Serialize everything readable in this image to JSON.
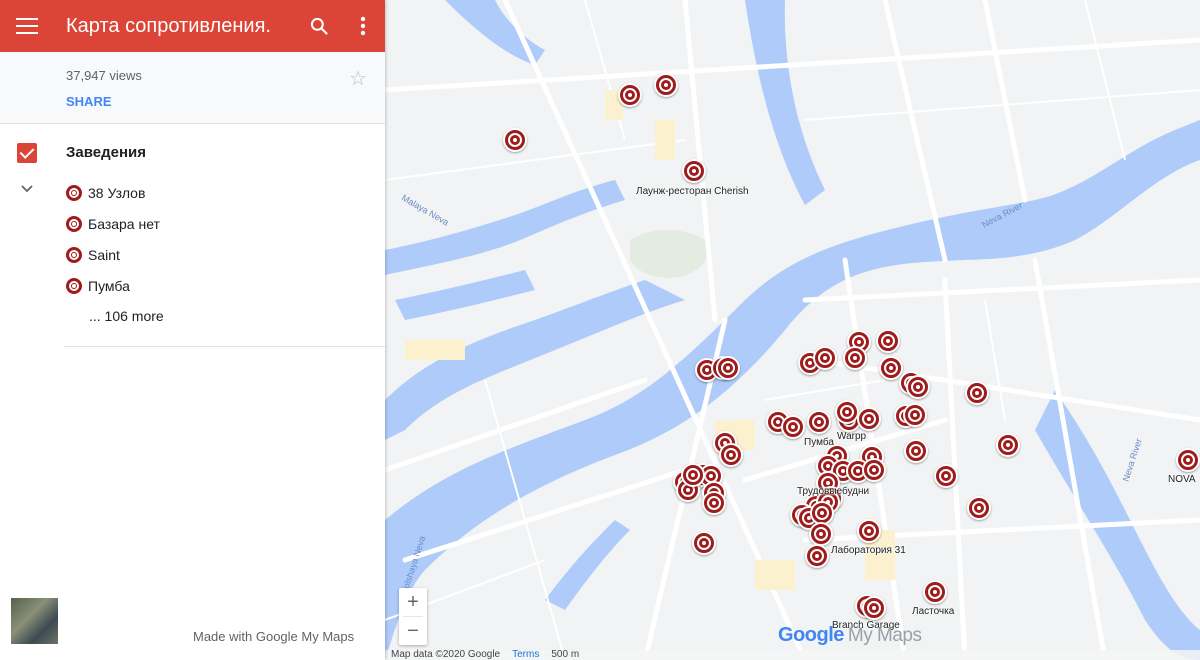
{
  "header": {
    "title": "Карта сопротивления.",
    "menu_icon": "menu-icon",
    "search_icon": "search-icon",
    "more_icon": "more-vert-icon",
    "color": "#db4437"
  },
  "stats": {
    "views": "37,947 views",
    "share": "SHARE"
  },
  "layer": {
    "name": "Заведения",
    "items": [
      "38 Узлов",
      "Базара нет",
      "Saint",
      "Пумба"
    ],
    "more": "... 106 more"
  },
  "footer": {
    "made_with": "Made with Google My Maps"
  },
  "map": {
    "labels": [
      "Лаунж-ресторан Cherish",
      "Пумба",
      "Warpp",
      "Трудовыебудни",
      "Лаборатория 31",
      "Branch Garage",
      "Ласточка",
      "NOVA"
    ],
    "river_labels": [
      "Neva River",
      "Neva River",
      "Bolshaya Neva",
      "Malaya Neva"
    ],
    "attribution": {
      "data": "Map data ©2020 Google",
      "terms": "Terms",
      "scale": "500 m"
    },
    "logo_text": "Google",
    "logo_suffix": "My Maps",
    "zoom_in": "+",
    "zoom_out": "−"
  }
}
